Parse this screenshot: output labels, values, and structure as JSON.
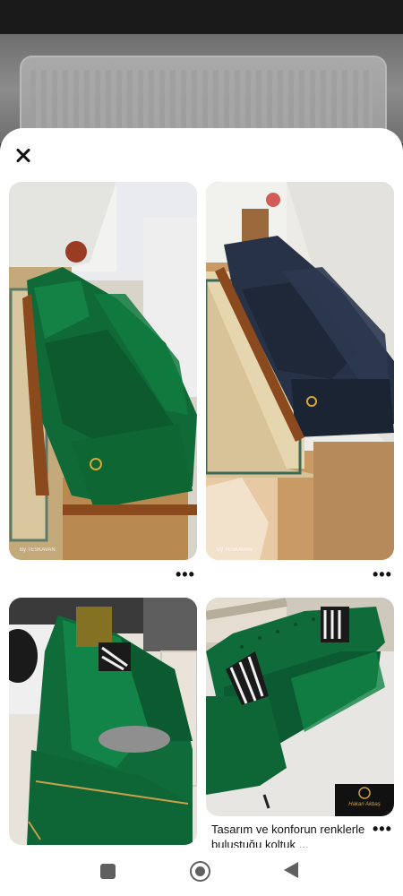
{
  "sheet": {
    "close_label": "Close"
  },
  "pins": [
    {
      "name": "pin-green-sofa-1",
      "watermark": "By TESKAVAN"
    },
    {
      "name": "pin-navy-sofa",
      "watermark": "By TESKAVAN"
    },
    {
      "name": "pin-green-sofa-2"
    },
    {
      "name": "pin-green-chesterfield",
      "caption": "Tasarım ve konforun renklerle bulustuğu koltuk ...",
      "brand_logo_text": "Hakan Akbaş"
    }
  ],
  "more_label": "•••",
  "icons": {
    "close": "close-icon",
    "recents": "square-icon",
    "home": "circle-icon",
    "back": "triangle-back-icon"
  },
  "colors": {
    "green_velvet": "#0e6b3a",
    "navy_velvet": "#1f2b3a",
    "sheet_bg": "#ffffff"
  }
}
